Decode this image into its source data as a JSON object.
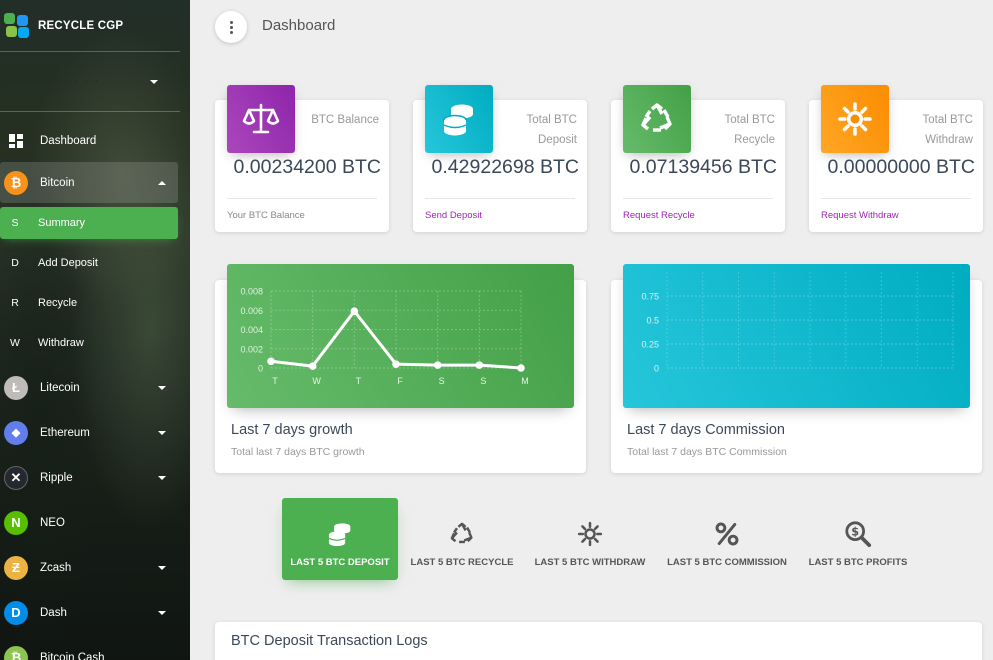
{
  "app": {
    "name": "RECYCLE CGP"
  },
  "user": {
    "name": "· · · · · · · · ·"
  },
  "header": {
    "title": "Dashboard"
  },
  "sidebar": {
    "items": [
      {
        "label": "Dashboard",
        "icon": "dashboard-icon"
      },
      {
        "label": "Bitcoin",
        "icon": "bitcoin-icon",
        "color": "#f7931a",
        "glyph": "₿"
      },
      {
        "abbr": "S",
        "label": "Summary"
      },
      {
        "abbr": "D",
        "label": "Add Deposit"
      },
      {
        "abbr": "R",
        "label": "Recycle"
      },
      {
        "abbr": "W",
        "label": "Withdraw"
      },
      {
        "label": "Litecoin",
        "icon": "litecoin-icon",
        "color": "#bfbbbb",
        "glyph": "Ł"
      },
      {
        "label": "Ethereum",
        "icon": "ethereum-icon",
        "color": "#627eea",
        "glyph": "◆"
      },
      {
        "label": "Ripple",
        "icon": "ripple-icon",
        "color": "#23292f",
        "glyph": "✕"
      },
      {
        "label": "NEO",
        "icon": "neo-icon",
        "color": "#58bf00",
        "glyph": "N"
      },
      {
        "label": "Zcash",
        "icon": "zcash-icon",
        "color": "#ecb244",
        "glyph": "Ƶ"
      },
      {
        "label": "Dash",
        "icon": "dash-icon",
        "color": "#008ce7",
        "glyph": "D"
      },
      {
        "label": "Bitcoin Cash",
        "icon": "bitcoin-cash-icon",
        "color": "#8dc351",
        "glyph": "₿"
      }
    ]
  },
  "stats": [
    {
      "category": "BTC Balance",
      "value": "0.00234200 BTC",
      "footer": "Your BTC Balance",
      "icon": "scale-icon",
      "color": "#9c27b0"
    },
    {
      "category": "Total BTC Deposit",
      "value": "0.42922698 BTC",
      "footer": "Send Deposit",
      "icon": "coins-icon",
      "color": "#00bcd4"
    },
    {
      "category": "Total BTC Recycle",
      "value": "0.07139456 BTC",
      "footer": "Request Recycle",
      "icon": "recycle-icon",
      "color": "#4caf50"
    },
    {
      "category": "Total BTC Withdraw",
      "value": "0.00000000 BTC",
      "footer": "Request Withdraw",
      "icon": "sun-icon",
      "color": "#ff9800"
    }
  ],
  "charts": [
    {
      "title": "Last 7 days growth",
      "subtitle": "Total last 7 days BTC growth",
      "color": "#4caf50"
    },
    {
      "title": "Last 7 days Commission",
      "subtitle": "Total last 7 days BTC Commission",
      "color": "#00bcd4"
    }
  ],
  "chart_data": [
    {
      "type": "line",
      "categories": [
        "T",
        "W",
        "T",
        "F",
        "S",
        "S",
        "M"
      ],
      "values": [
        0.0007,
        0.0002,
        0.0059,
        0.0004,
        0.0003,
        0.0003,
        0.0
      ],
      "yticks": [
        "0",
        "0.002",
        "0.004",
        "0.006",
        "0.008"
      ],
      "ylim": [
        0,
        0.008
      ],
      "title": "Last 7 days growth",
      "grid": true
    },
    {
      "type": "line",
      "categories": [],
      "values": [],
      "yticks": [
        "0",
        "0.25",
        "0.5",
        "0.75"
      ],
      "ylim": [
        0,
        1
      ],
      "title": "Last 7 days Commission",
      "grid": true
    }
  ],
  "tabs": [
    {
      "label": "LAST 5 BTC DEPOSIT",
      "icon": "coins-icon",
      "active": true
    },
    {
      "label": "LAST 5 BTC RECYCLE",
      "icon": "recycle-icon"
    },
    {
      "label": "LAST 5 BTC WITHDRAW",
      "icon": "sun-icon"
    },
    {
      "label": "LAST 5 BTC COMMISSION",
      "icon": "percent-icon"
    },
    {
      "label": "LAST 5 BTC PROFITS",
      "icon": "search-dollar-icon"
    }
  ],
  "logs": {
    "title": "BTC Deposit Transaction Logs"
  }
}
